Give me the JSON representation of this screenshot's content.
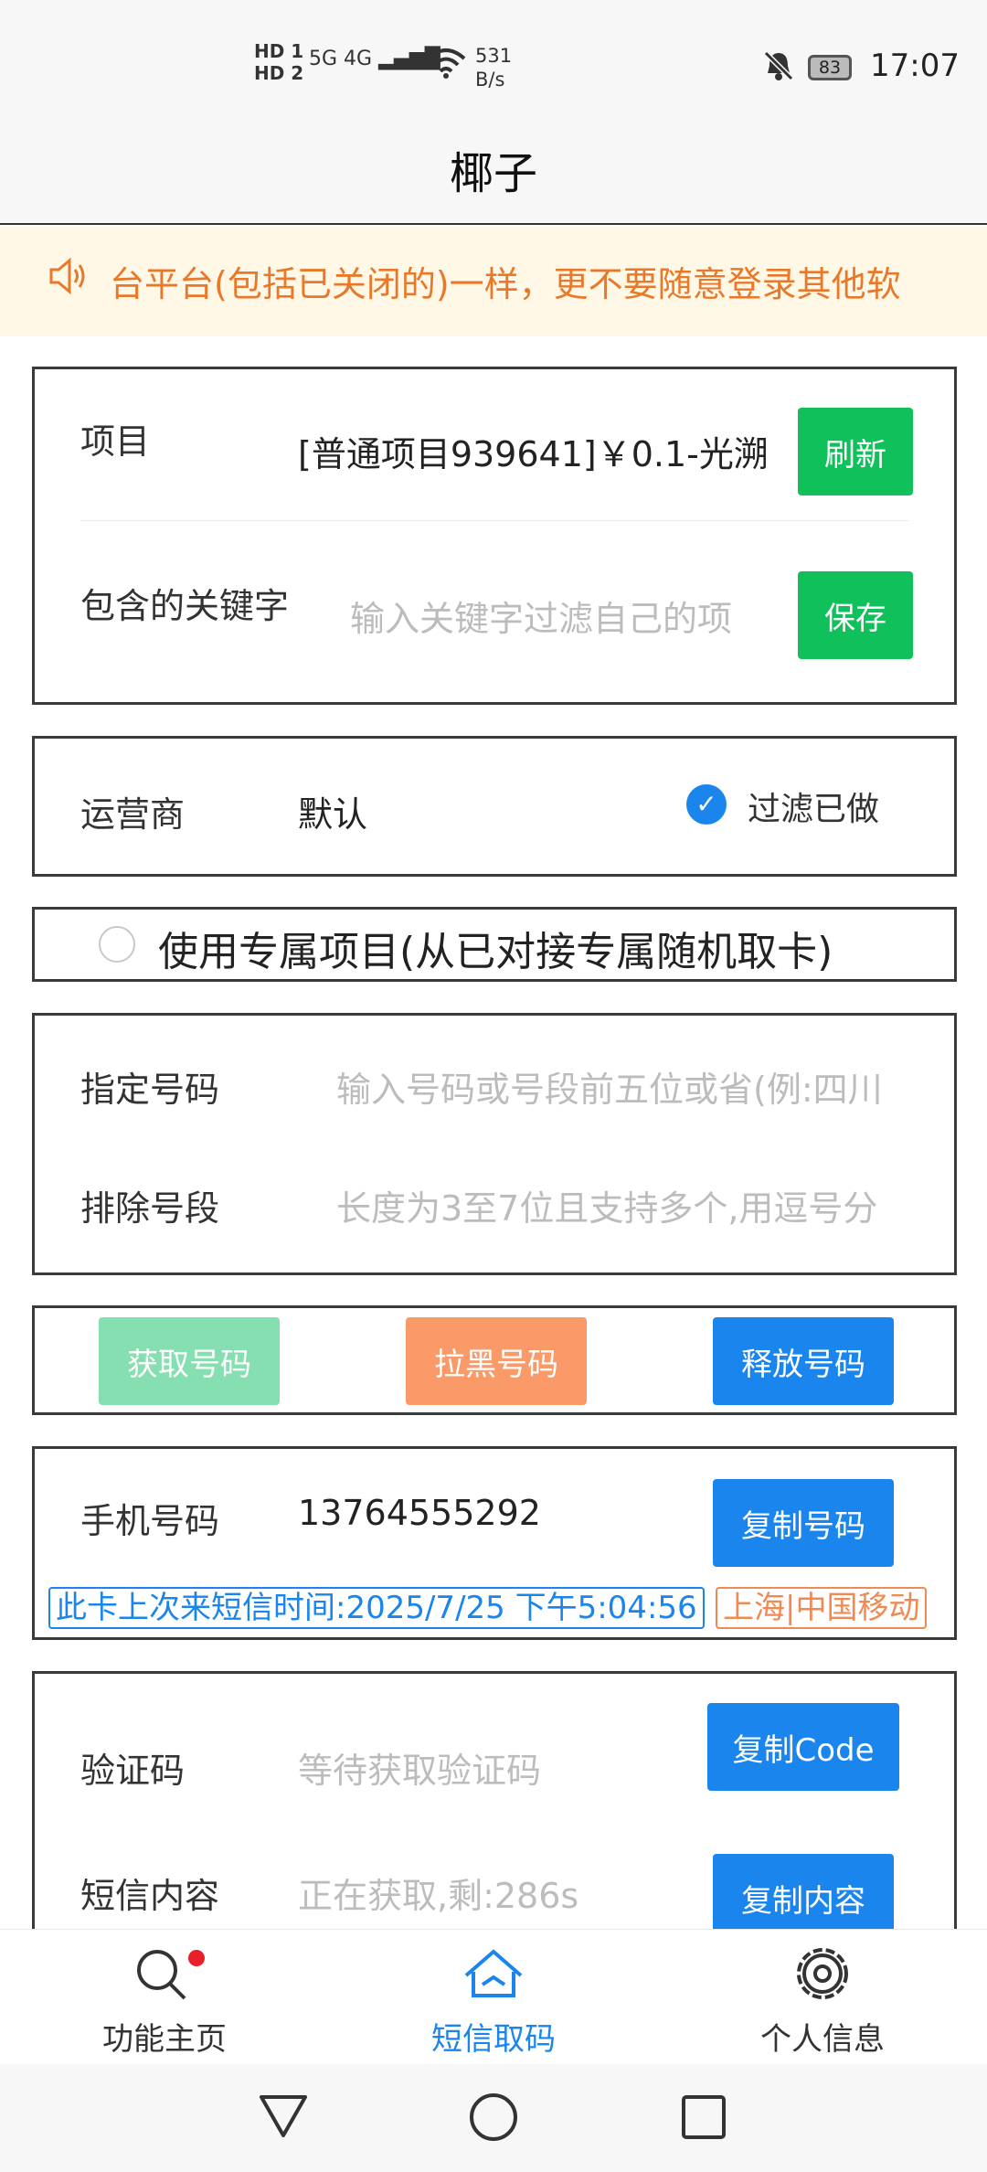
{
  "status_bar": {
    "hd1": "HD 1",
    "hd2": "HD 2",
    "signal": "5G 4G",
    "speed_value": "531",
    "speed_unit": "B/s",
    "battery": "83",
    "time": "17:07"
  },
  "header": {
    "title": "椰子"
  },
  "notice": {
    "text": "台平台(包括已关闭的)一样，更不要随意登录其他软"
  },
  "project_card": {
    "project_label": "项目",
    "project_value": "[普通项目939641]￥0.1-光溯",
    "refresh_button": "刷新",
    "keyword_label": "包含的关键字",
    "keyword_placeholder": "输入关键字过滤自己的项",
    "save_button": "保存"
  },
  "operator_card": {
    "label": "运营商",
    "value": "默认",
    "filter_label": "过滤已做",
    "filter_checked": true
  },
  "exclusive": {
    "label": "使用专属项目(从已对接专属随机取卡)",
    "checked": false
  },
  "number_card": {
    "specified_label": "指定号码",
    "specified_placeholder": "输入号码或号段前五位或省(例:四川",
    "exclude_label": "排除号段",
    "exclude_placeholder": "长度为3至7位且支持多个,用逗号分"
  },
  "actions": {
    "get_number": "获取号码",
    "blacklist_number": "拉黑号码",
    "release_number": "释放号码"
  },
  "phone_card": {
    "label": "手机号码",
    "value": "13764555292",
    "copy_button": "复制号码",
    "last_sms_tag": "此卡上次来短信时间:2025/7/25 下午5:04:56",
    "carrier_tag": "上海|中国移动"
  },
  "code_card": {
    "code_label": "验证码",
    "code_placeholder": "等待获取验证码",
    "copy_code_button": "复制Code",
    "sms_label": "短信内容",
    "sms_placeholder": "正在获取,剩:286s",
    "copy_content_button": "复制内容"
  },
  "tabs": [
    {
      "label": "功能主页",
      "icon": "search-icon",
      "badge": true
    },
    {
      "label": "短信取码",
      "icon": "home-icon",
      "active": true
    },
    {
      "label": "个人信息",
      "icon": "gear-icon"
    }
  ],
  "colors": {
    "accent_blue": "#1b85ee",
    "green": "#10c15b",
    "orange": "#fa9a68",
    "notice_text": "#e8792a",
    "notice_bg": "#fff8e6"
  }
}
